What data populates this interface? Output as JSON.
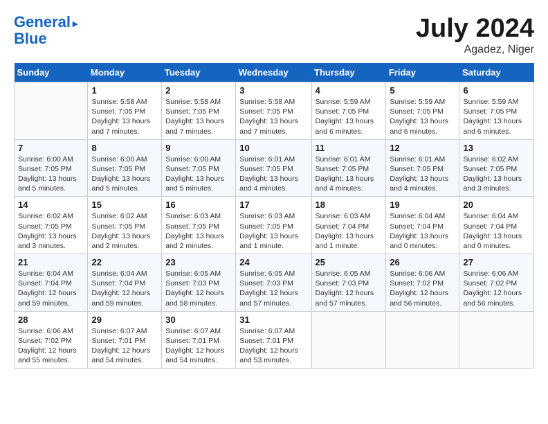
{
  "header": {
    "logo_line1": "General",
    "logo_line2": "Blue",
    "month": "July 2024",
    "location": "Agadez, Niger"
  },
  "days_of_week": [
    "Sunday",
    "Monday",
    "Tuesday",
    "Wednesday",
    "Thursday",
    "Friday",
    "Saturday"
  ],
  "weeks": [
    [
      {
        "day": "",
        "info": ""
      },
      {
        "day": "1",
        "info": "Sunrise: 5:58 AM\nSunset: 7:05 PM\nDaylight: 13 hours\nand 7 minutes."
      },
      {
        "day": "2",
        "info": "Sunrise: 5:58 AM\nSunset: 7:05 PM\nDaylight: 13 hours\nand 7 minutes."
      },
      {
        "day": "3",
        "info": "Sunrise: 5:58 AM\nSunset: 7:05 PM\nDaylight: 13 hours\nand 7 minutes."
      },
      {
        "day": "4",
        "info": "Sunrise: 5:59 AM\nSunset: 7:05 PM\nDaylight: 13 hours\nand 6 minutes."
      },
      {
        "day": "5",
        "info": "Sunrise: 5:59 AM\nSunset: 7:05 PM\nDaylight: 13 hours\nand 6 minutes."
      },
      {
        "day": "6",
        "info": "Sunrise: 5:59 AM\nSunset: 7:05 PM\nDaylight: 13 hours\nand 6 minutes."
      }
    ],
    [
      {
        "day": "7",
        "info": "Sunrise: 6:00 AM\nSunset: 7:05 PM\nDaylight: 13 hours\nand 5 minutes."
      },
      {
        "day": "8",
        "info": "Sunrise: 6:00 AM\nSunset: 7:05 PM\nDaylight: 13 hours\nand 5 minutes."
      },
      {
        "day": "9",
        "info": "Sunrise: 6:00 AM\nSunset: 7:05 PM\nDaylight: 13 hours\nand 5 minutes."
      },
      {
        "day": "10",
        "info": "Sunrise: 6:01 AM\nSunset: 7:05 PM\nDaylight: 13 hours\nand 4 minutes."
      },
      {
        "day": "11",
        "info": "Sunrise: 6:01 AM\nSunset: 7:05 PM\nDaylight: 13 hours\nand 4 minutes."
      },
      {
        "day": "12",
        "info": "Sunrise: 6:01 AM\nSunset: 7:05 PM\nDaylight: 13 hours\nand 4 minutes."
      },
      {
        "day": "13",
        "info": "Sunrise: 6:02 AM\nSunset: 7:05 PM\nDaylight: 13 hours\nand 3 minutes."
      }
    ],
    [
      {
        "day": "14",
        "info": "Sunrise: 6:02 AM\nSunset: 7:05 PM\nDaylight: 13 hours\nand 3 minutes."
      },
      {
        "day": "15",
        "info": "Sunrise: 6:02 AM\nSunset: 7:05 PM\nDaylight: 13 hours\nand 2 minutes."
      },
      {
        "day": "16",
        "info": "Sunrise: 6:03 AM\nSunset: 7:05 PM\nDaylight: 13 hours\nand 2 minutes."
      },
      {
        "day": "17",
        "info": "Sunrise: 6:03 AM\nSunset: 7:05 PM\nDaylight: 13 hours\nand 1 minute."
      },
      {
        "day": "18",
        "info": "Sunrise: 6:03 AM\nSunset: 7:04 PM\nDaylight: 13 hours\nand 1 minute."
      },
      {
        "day": "19",
        "info": "Sunrise: 6:04 AM\nSunset: 7:04 PM\nDaylight: 13 hours\nand 0 minutes."
      },
      {
        "day": "20",
        "info": "Sunrise: 6:04 AM\nSunset: 7:04 PM\nDaylight: 13 hours\nand 0 minutes."
      }
    ],
    [
      {
        "day": "21",
        "info": "Sunrise: 6:04 AM\nSunset: 7:04 PM\nDaylight: 12 hours\nand 59 minutes."
      },
      {
        "day": "22",
        "info": "Sunrise: 6:04 AM\nSunset: 7:04 PM\nDaylight: 12 hours\nand 59 minutes."
      },
      {
        "day": "23",
        "info": "Sunrise: 6:05 AM\nSunset: 7:03 PM\nDaylight: 12 hours\nand 58 minutes."
      },
      {
        "day": "24",
        "info": "Sunrise: 6:05 AM\nSunset: 7:03 PM\nDaylight: 12 hours\nand 57 minutes."
      },
      {
        "day": "25",
        "info": "Sunrise: 6:05 AM\nSunset: 7:03 PM\nDaylight: 12 hours\nand 57 minutes."
      },
      {
        "day": "26",
        "info": "Sunrise: 6:06 AM\nSunset: 7:02 PM\nDaylight: 12 hours\nand 56 minutes."
      },
      {
        "day": "27",
        "info": "Sunrise: 6:06 AM\nSunset: 7:02 PM\nDaylight: 12 hours\nand 56 minutes."
      }
    ],
    [
      {
        "day": "28",
        "info": "Sunrise: 6:06 AM\nSunset: 7:02 PM\nDaylight: 12 hours\nand 55 minutes."
      },
      {
        "day": "29",
        "info": "Sunrise: 6:07 AM\nSunset: 7:01 PM\nDaylight: 12 hours\nand 54 minutes."
      },
      {
        "day": "30",
        "info": "Sunrise: 6:07 AM\nSunset: 7:01 PM\nDaylight: 12 hours\nand 54 minutes."
      },
      {
        "day": "31",
        "info": "Sunrise: 6:07 AM\nSunset: 7:01 PM\nDaylight: 12 hours\nand 53 minutes."
      },
      {
        "day": "",
        "info": ""
      },
      {
        "day": "",
        "info": ""
      },
      {
        "day": "",
        "info": ""
      }
    ]
  ]
}
